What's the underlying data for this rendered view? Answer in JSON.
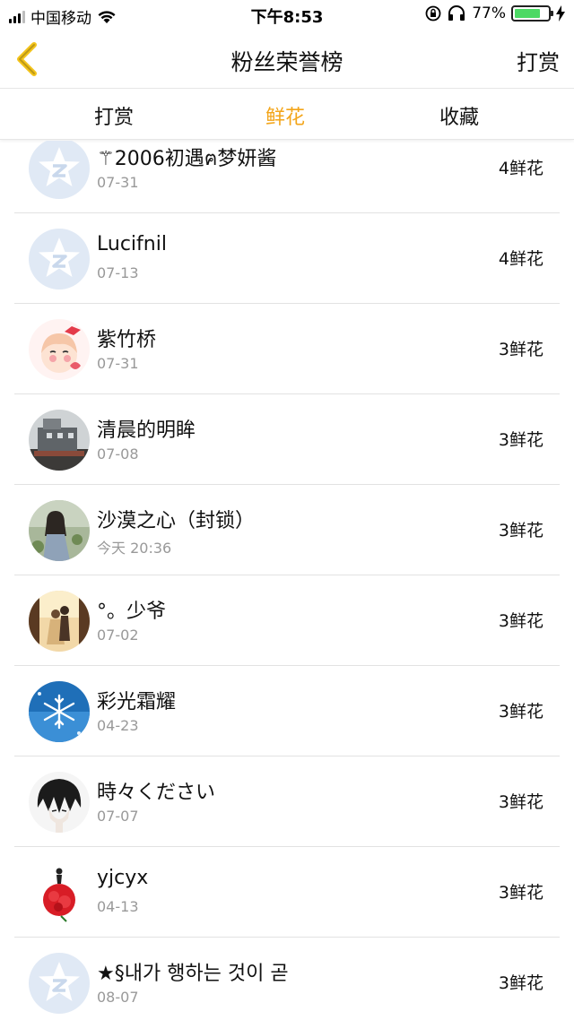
{
  "status_bar": {
    "carrier": "中国移动",
    "time": "下午8:53",
    "battery_percent": "77%",
    "battery_level": 0.77
  },
  "nav": {
    "title": "粉丝荣誉榜",
    "right_label": "打赏"
  },
  "tabs": [
    {
      "label": "打赏",
      "active": false
    },
    {
      "label": "鲜花",
      "active": true
    },
    {
      "label": "收藏",
      "active": false
    }
  ],
  "colors": {
    "accent": "#f3a51a",
    "back_arrow": "#f3c31a",
    "divider": "#e2e2e2",
    "muted_text": "#999999"
  },
  "list": [
    {
      "name": "⚚2006初遇ฅ梦妍酱",
      "date": "07-31",
      "count": "4鲜花",
      "avatar": "default-qq-icon"
    },
    {
      "name": "Lucifnil",
      "date": "07-13",
      "count": "4鲜花",
      "avatar": "default-qq-icon"
    },
    {
      "name": "紫竹桥",
      "date": "07-31",
      "count": "3鲜花",
      "avatar": "cartoon-girl-avatar"
    },
    {
      "name": "清晨的明眸",
      "date": "07-08",
      "count": "3鲜花",
      "avatar": "ship-photo-avatar"
    },
    {
      "name": "沙漠之心（封锁）",
      "date": "今天 20:36",
      "count": "3鲜花",
      "avatar": "girl-garden-avatar"
    },
    {
      "name": "°。少爷",
      "date": "07-02",
      "count": "3鲜花",
      "avatar": "couple-sunset-avatar"
    },
    {
      "name": "彩光霜耀",
      "date": "04-23",
      "count": "3鲜花",
      "avatar": "snowflake-avatar"
    },
    {
      "name": "時々ください",
      "date": "07-07",
      "count": "3鲜花",
      "avatar": "anime-boy-avatar"
    },
    {
      "name": "yjcyx",
      "date": "04-13",
      "count": "3鲜花",
      "avatar": "red-dress-avatar"
    },
    {
      "name": "★§내가 행하는 것이 곧",
      "date": "08-07",
      "count": "3鲜花",
      "avatar": "default-qq-icon"
    }
  ]
}
